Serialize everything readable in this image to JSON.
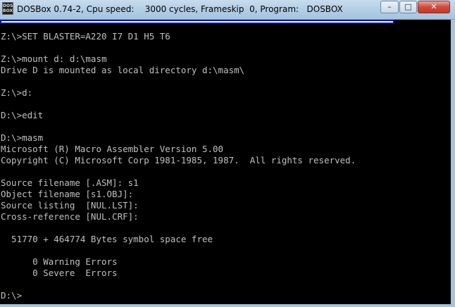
{
  "window": {
    "icon_text": "DOS BOX",
    "title": "DOSBox 0.74-2, Cpu speed:    3000 cycles, Frameskip  0, Program:   DOSBOX",
    "minimize_label": "–",
    "maximize_label": "□",
    "close_label": "✕"
  },
  "console": {
    "lines": [
      "Z:\\>SET BLASTER=A220 I7 D1 H5 T6",
      "",
      "Z:\\>mount d: d:\\masm",
      "Drive D is mounted as local directory d:\\masm\\",
      "",
      "Z:\\>d:",
      "",
      "D:\\>edit",
      "",
      "D:\\>masm",
      "Microsoft (R) Macro Assembler Version 5.00",
      "Copyright (C) Microsoft Corp 1981-1985, 1987.  All rights reserved.",
      "",
      "Source filename [.ASM]: s1",
      "Object filename [s1.OBJ]:",
      "Source listing  [NUL.LST]:",
      "Cross-reference [NUL.CRF]:",
      "",
      "  51770 + 464774 Bytes symbol space free",
      "",
      "      0 Warning Errors",
      "      0 Severe  Errors",
      "",
      "D:\\>"
    ]
  }
}
